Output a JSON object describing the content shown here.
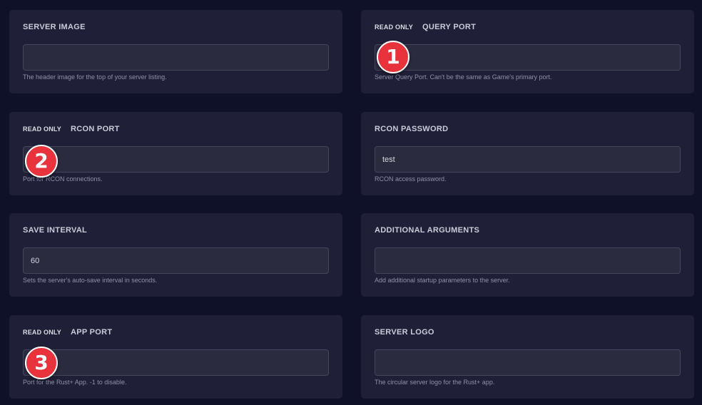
{
  "read_only_badge": "READ ONLY",
  "fields": {
    "server_image": {
      "label": "SERVER IMAGE",
      "value": "",
      "help": "The header image for the top of your server listing."
    },
    "query_port": {
      "label": "QUERY PORT",
      "value": "",
      "help": "Server Query Port. Can't be the same as Game's primary port."
    },
    "rcon_port": {
      "label": "RCON PORT",
      "value": "",
      "help": "Port for RCON connections."
    },
    "rcon_password": {
      "label": "RCON PASSWORD",
      "value": "test",
      "help": "RCON access password."
    },
    "save_interval": {
      "label": "SAVE INTERVAL",
      "value": "60",
      "help": "Sets the server's auto-save interval in seconds."
    },
    "additional_arguments": {
      "label": "ADDITIONAL ARGUMENTS",
      "value": "",
      "help": "Add additional startup parameters to the server."
    },
    "app_port": {
      "label": "APP PORT",
      "value": "",
      "help": "Port for the Rust+ App. -1 to disable."
    },
    "server_logo": {
      "label": "SERVER LOGO",
      "value": "",
      "help": "The circular server logo for the Rust+ app."
    }
  },
  "markers": [
    "1",
    "2",
    "3"
  ],
  "colors": {
    "background": "#0f1128",
    "card": "#1f2038",
    "input": "#2a2b3f",
    "marker": "#e8333d"
  }
}
